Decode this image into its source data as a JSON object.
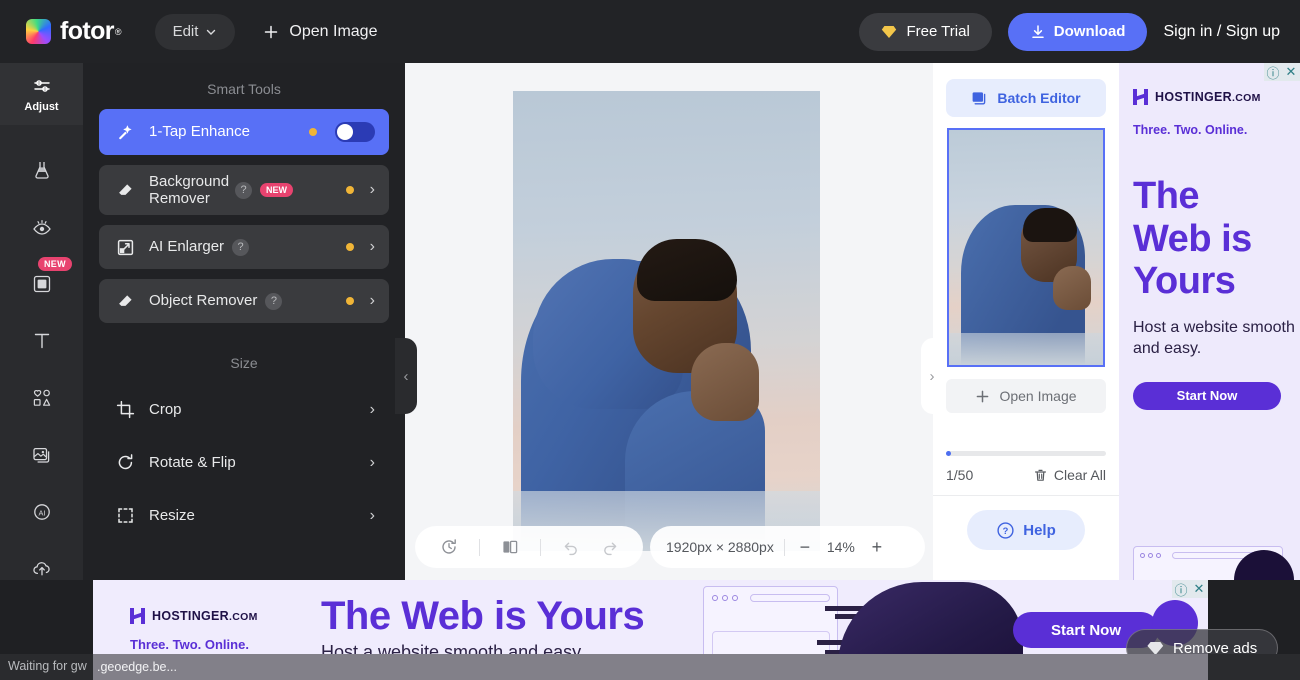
{
  "header": {
    "logo_text": "fotor",
    "logo_registered": "®",
    "edit_label": "Edit",
    "open_image_label": "Open Image",
    "free_trial_label": "Free Trial",
    "download_label": "Download",
    "signin_label": "Sign in / Sign up",
    "accent_color": "#5870f6"
  },
  "rail": {
    "items": [
      {
        "name": "adjust",
        "icon": "sliders-icon",
        "label": "Adjust",
        "active": true
      },
      {
        "name": "beauty",
        "icon": "flask-icon",
        "label": ""
      },
      {
        "name": "retouch",
        "icon": "eye-icon",
        "label": ""
      },
      {
        "name": "frame",
        "icon": "frame-icon",
        "label": "",
        "badge": "NEW"
      },
      {
        "name": "text",
        "icon": "text-icon",
        "label": ""
      },
      {
        "name": "elements",
        "icon": "shapes-icon",
        "label": ""
      },
      {
        "name": "stickers",
        "icon": "photos-icon",
        "label": ""
      },
      {
        "name": "ai",
        "icon": "ai-circle-icon",
        "label": ""
      },
      {
        "name": "upload",
        "icon": "cloud-upload-icon",
        "label": ""
      }
    ]
  },
  "tools": {
    "smart_tools_title": "Smart Tools",
    "smart_tools": [
      {
        "label": "1-Tap Enhance",
        "icon": "magic-wand-icon",
        "has_help": false,
        "badge": "",
        "pro_dot": true,
        "control": "toggle",
        "toggle_on": true,
        "selected": true
      },
      {
        "label": "Background Remover",
        "icon": "eraser-icon",
        "has_help": true,
        "badge": "NEW",
        "pro_dot": true,
        "control": "chevron",
        "selected": false
      },
      {
        "label": "AI Enlarger",
        "icon": "enlarge-icon",
        "has_help": true,
        "badge": "",
        "pro_dot": true,
        "control": "chevron",
        "selected": false
      },
      {
        "label": "Object Remover",
        "icon": "eraser-icon",
        "has_help": true,
        "badge": "",
        "pro_dot": true,
        "control": "chevron",
        "selected": false
      }
    ],
    "size_title": "Size",
    "size_items": [
      {
        "label": "Crop",
        "icon": "crop-icon"
      },
      {
        "label": "Rotate & Flip",
        "icon": "rotate-icon"
      },
      {
        "label": "Resize",
        "icon": "resize-icon"
      }
    ]
  },
  "canvas": {
    "collapse_left_icon": "chevron-left-icon",
    "collapse_right_icon": "chevron-right-icon",
    "toolbar": {
      "history_icon": "history-reset-icon",
      "compare_icon": "compare-icon",
      "undo_icon": "undo-icon",
      "redo_icon": "redo-icon",
      "dimensions": "1920px × 2880px",
      "zoom_out": "−",
      "zoom_level": "14%",
      "zoom_in": "+"
    }
  },
  "batch": {
    "editor_label": "Batch Editor",
    "editor_icon": "layers-icon",
    "open_image_label": "Open Image",
    "count": "1/50",
    "clear_all_label": "Clear All",
    "clear_all_icon": "trash-icon",
    "help_label": "Help",
    "help_icon": "question-circle-icon",
    "accent_color": "#3f63e0"
  },
  "ad_right": {
    "brand": "HOSTINGER",
    "brand_suffix": ".COM",
    "tagline": "Three. Two. Online.",
    "headline_line1": "The",
    "headline_line2": "Web is",
    "headline_line3": "Yours",
    "subtext": "Host a website smooth and easy.",
    "cta_label": "Start Now",
    "info_icon": "info-icon",
    "close_icon": "close-icon",
    "brand_color": "#5a2fd6"
  },
  "ad_bottom": {
    "brand": "HOSTINGER",
    "brand_suffix": ".COM",
    "tagline": "Three. Two. Online.",
    "headline": "The Web is Yours",
    "subtext": "Host a website smooth and easy.",
    "cta_label": "Start Now",
    "info_icon": "info-icon",
    "close_icon": "close-icon"
  },
  "remove_ads": {
    "label": "Remove ads",
    "icon": "diamond-icon"
  },
  "status": {
    "text": "Waiting for gw",
    "overlay_text": ".geoedge.be..."
  }
}
